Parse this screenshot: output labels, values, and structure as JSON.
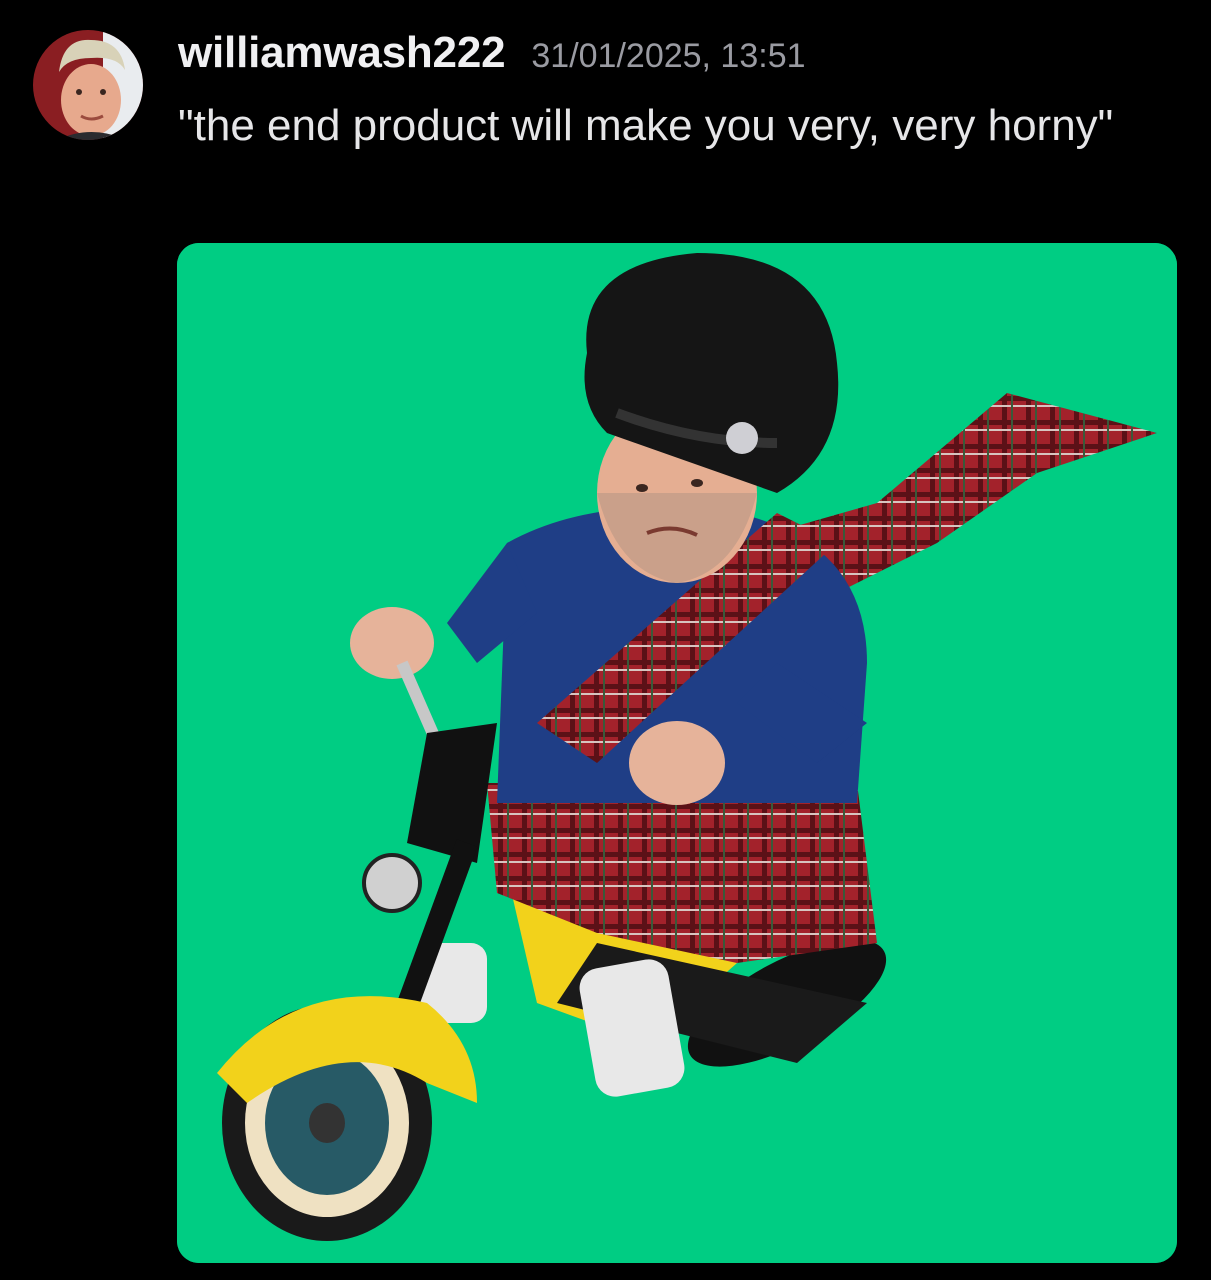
{
  "message": {
    "author": {
      "username": "williamwash222",
      "avatar_icon": "user-avatar"
    },
    "timestamp": "31/01/2025, 13:51",
    "content": "\"the end product will make you very, very horny\"",
    "attachment": {
      "type": "image",
      "background_color": "#00cd83"
    }
  }
}
